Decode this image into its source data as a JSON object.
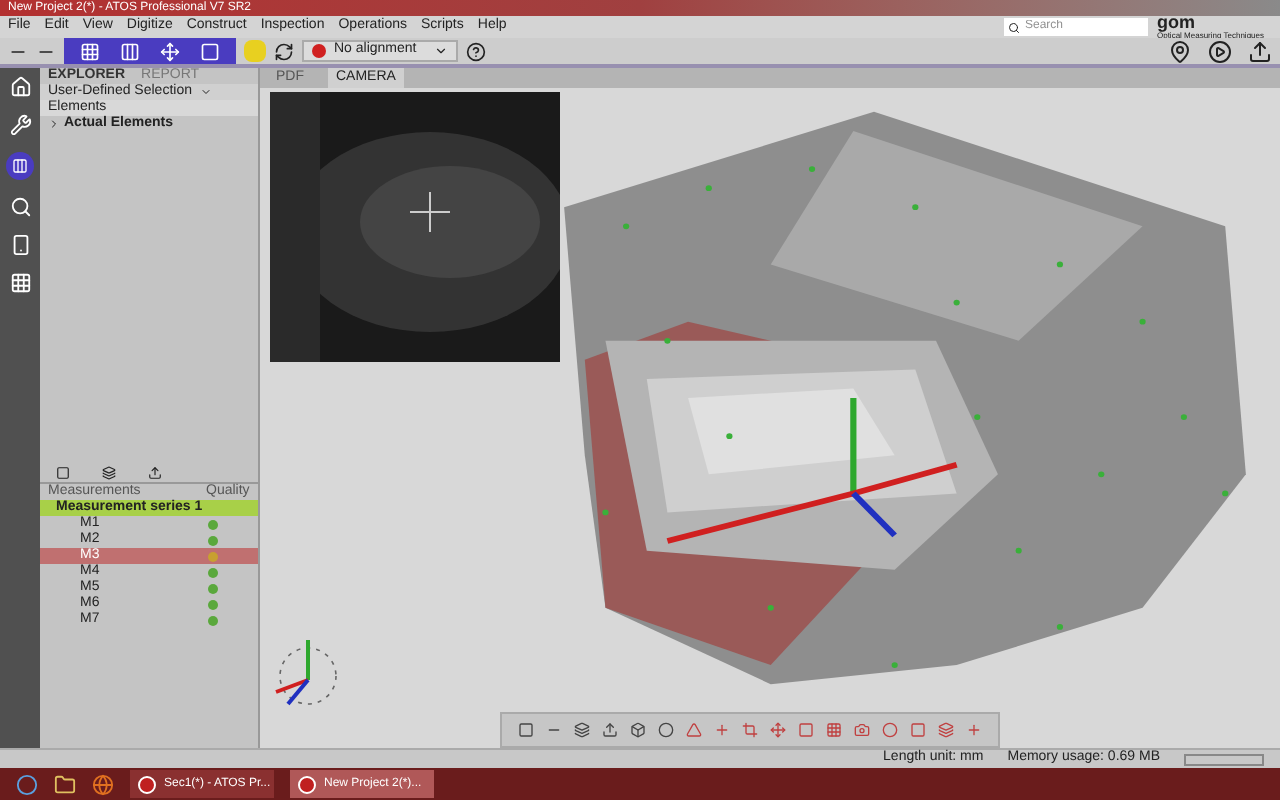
{
  "window": {
    "title": "New Project 2(*) - ATOS Professional V7 SR2"
  },
  "menu": [
    "File",
    "Edit",
    "View",
    "Digitize",
    "Construct",
    "Inspection",
    "Operations",
    "Scripts",
    "Help"
  ],
  "search": {
    "placeholder": "Search"
  },
  "brand": {
    "name": "gom",
    "tagline": "Optical Measuring Techniques"
  },
  "alignment": {
    "value": "No alignment"
  },
  "explorer_tabs": [
    {
      "label": "EXPLORER",
      "selected": true
    },
    {
      "label": "REPORT",
      "selected": false
    }
  ],
  "selection": "User-Defined Selection",
  "elements": {
    "header": "Elements",
    "items": [
      {
        "label": "Actual Elements",
        "expanded": false
      }
    ]
  },
  "view_tabs": [
    {
      "label": "PDF",
      "selected": false
    },
    {
      "label": "CAMERA",
      "selected": true
    }
  ],
  "measurements": {
    "columns": [
      "Measurements",
      "Quality"
    ],
    "series": "Measurement series 1",
    "rows": [
      {
        "label": "M1",
        "selected": false,
        "color": "#5aa83c"
      },
      {
        "label": "M2",
        "selected": false,
        "color": "#5aa83c"
      },
      {
        "label": "M3",
        "selected": true,
        "color": "#c8a030"
      },
      {
        "label": "M4",
        "selected": false,
        "color": "#5aa83c"
      },
      {
        "label": "M5",
        "selected": false,
        "color": "#5aa83c"
      },
      {
        "label": "M6",
        "selected": false,
        "color": "#5aa83c"
      },
      {
        "label": "M7",
        "selected": false,
        "color": "#5aa83c"
      }
    ]
  },
  "status": {
    "unit": "Length unit: mm",
    "memory": "Memory usage: 0.69 MB"
  },
  "taskbar": [
    {
      "label": "Sec1(*) - ATOS Pr...",
      "selected": false
    },
    {
      "label": "New Project 2(*)...",
      "selected": true
    }
  ]
}
